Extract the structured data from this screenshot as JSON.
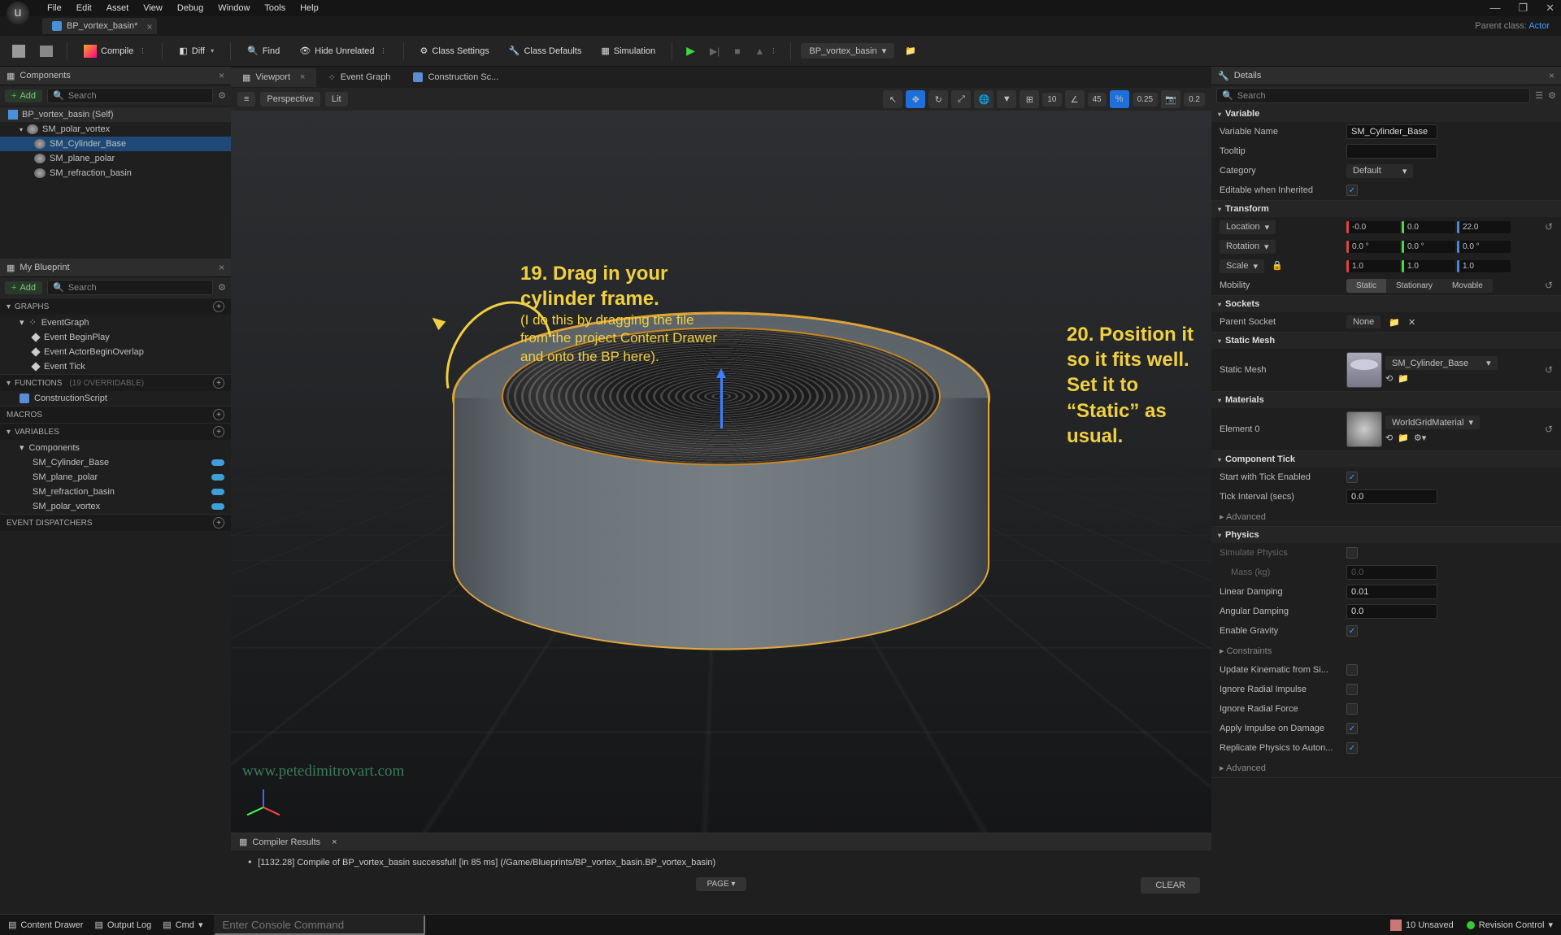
{
  "menubar": {
    "items": [
      "File",
      "Edit",
      "Asset",
      "View",
      "Debug",
      "Window",
      "Tools",
      "Help"
    ]
  },
  "tab": {
    "title": "BP_vortex_basin*"
  },
  "parent_class": {
    "label": "Parent class:",
    "value": "Actor"
  },
  "toolbar": {
    "compile": "Compile",
    "diff": "Diff",
    "find": "Find",
    "hide_unrelated": "Hide Unrelated",
    "class_settings": "Class Settings",
    "class_defaults": "Class Defaults",
    "simulation": "Simulation",
    "bp_dropdown": "BP_vortex_basin"
  },
  "components": {
    "title": "Components",
    "add": "Add",
    "search_placeholder": "Search",
    "tree": {
      "root": "BP_vortex_basin (Self)",
      "items": [
        "SM_polar_vortex",
        "SM_Cylinder_Base",
        "SM_plane_polar",
        "SM_refraction_basin"
      ]
    }
  },
  "myblueprint": {
    "title": "My Blueprint",
    "add": "Add",
    "search_placeholder": "Search",
    "graphs": {
      "title": "GRAPHS",
      "root": "EventGraph",
      "items": [
        "Event BeginPlay",
        "Event ActorBeginOverlap",
        "Event Tick"
      ]
    },
    "functions": {
      "title": "FUNCTIONS",
      "suffix": "(19 OVERRIDABLE)",
      "items": [
        "ConstructionScript"
      ]
    },
    "macros": {
      "title": "MACROS"
    },
    "variables": {
      "title": "VARIABLES",
      "group": "Components",
      "items": [
        "SM_Cylinder_Base",
        "SM_plane_polar",
        "SM_refraction_basin",
        "SM_polar_vortex"
      ]
    },
    "dispatchers": {
      "title": "EVENT DISPATCHERS"
    }
  },
  "center_tabs": {
    "viewport": "Viewport",
    "event_graph": "Event Graph",
    "construction": "Construction Sc..."
  },
  "viewport_bar": {
    "perspective": "Perspective",
    "lit": "Lit",
    "grid": "10",
    "angle": "45",
    "snap": "0.25",
    "cam": "0.2"
  },
  "annotations": {
    "a1_title": "19. Drag in your",
    "a1_title2": "cylinder frame.",
    "a1_sub1": "(I do this by dragging the file",
    "a1_sub2": "from the project Content Drawer",
    "a1_sub3": "and onto the BP here).",
    "a2_l1": "20. Position it so it fits well.",
    "a2_l2": "Set it to “Static” as usual."
  },
  "compiler": {
    "title": "Compiler Results",
    "msg": "[1132.28] Compile of BP_vortex_basin successful! [in 85 ms] (/Game/Blueprints/BP_vortex_basin.BP_vortex_basin)",
    "page": "PAGE",
    "clear": "CLEAR"
  },
  "watermark": "www.petedimitrovart.com",
  "details": {
    "title": "Details",
    "search_placeholder": "Search",
    "variable": {
      "h": "Variable",
      "name_l": "Variable Name",
      "name_v": "SM_Cylinder_Base",
      "tooltip_l": "Tooltip",
      "category_l": "Category",
      "category_v": "Default",
      "editable_l": "Editable when Inherited"
    },
    "transform": {
      "h": "Transform",
      "location_l": "Location",
      "loc": [
        "-0.0",
        "0.0",
        "22.0"
      ],
      "rotation_l": "Rotation",
      "rot": [
        "0.0 °",
        "0.0 °",
        "0.0 °"
      ],
      "scale_l": "Scale",
      "scale": [
        "1.0",
        "1.0",
        "1.0"
      ],
      "mobility_l": "Mobility",
      "mob": [
        "Static",
        "Stationary",
        "Movable"
      ]
    },
    "sockets": {
      "h": "Sockets",
      "parent_l": "Parent Socket",
      "parent_v": "None"
    },
    "static_mesh": {
      "h": "Static Mesh",
      "label": "Static Mesh",
      "value": "SM_Cylinder_Base"
    },
    "materials": {
      "h": "Materials",
      "el0_l": "Element 0",
      "el0_v": "WorldGridMaterial"
    },
    "component_tick": {
      "h": "Component Tick",
      "start_l": "Start with Tick Enabled",
      "interval_l": "Tick Interval (secs)",
      "interval_v": "0.0",
      "adv": "Advanced"
    },
    "physics": {
      "h": "Physics",
      "sim_l": "Simulate Physics",
      "mass_l": "Mass (kg)",
      "mass_v": "0.0",
      "lin_l": "Linear Damping",
      "lin_v": "0.01",
      "ang_l": "Angular Damping",
      "ang_v": "0.0",
      "grav_l": "Enable Gravity",
      "constraints": "Constraints",
      "kin_l": "Update Kinematic from Si...",
      "rad_imp_l": "Ignore Radial Impulse",
      "rad_for_l": "Ignore Radial Force",
      "apply_l": "Apply Impulse on Damage",
      "repl_l": "Replicate Physics to Auton...",
      "adv": "Advanced"
    }
  },
  "statusbar": {
    "content_drawer": "Content Drawer",
    "output_log": "Output Log",
    "cmd": "Cmd",
    "cmd_placeholder": "Enter Console Command",
    "unsaved": "10 Unsaved",
    "revision": "Revision Control"
  }
}
